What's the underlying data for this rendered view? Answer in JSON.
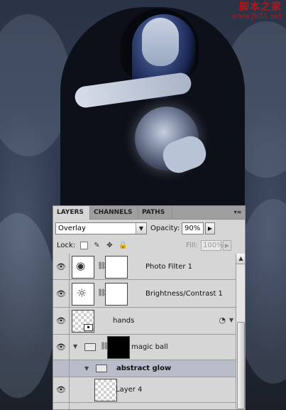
{
  "watermark": {
    "line1": "脚本之家",
    "line2": "www.Jb51.net"
  },
  "panel": {
    "tabs": [
      {
        "label": "LAYERS",
        "active": true
      },
      {
        "label": "CHANNELS",
        "active": false
      },
      {
        "label": "PATHS",
        "active": false
      }
    ],
    "menu_icon": "panel-menu-icon",
    "blend_mode": "Overlay",
    "opacity_label": "Opacity:",
    "opacity_value": "90%",
    "lock_label": "Lock:",
    "fill_label": "Fill:",
    "fill_value": "100%"
  },
  "layers": [
    {
      "name": "Photo Filter 1",
      "kind": "adjustment",
      "icon": "photo-filter-icon",
      "visible": true
    },
    {
      "name": "Brightness/Contrast 1",
      "kind": "adjustment",
      "icon": "brightness-contrast-icon",
      "visible": true
    },
    {
      "name": "hands",
      "kind": "smart-object",
      "visible": true,
      "has_effects": true
    },
    {
      "name": "magic ball",
      "kind": "group",
      "visible": true,
      "expanded": true
    },
    {
      "name": "abstract glow",
      "kind": "group",
      "visible": false,
      "expanded": true,
      "selected": true
    },
    {
      "name": "Layer 4",
      "kind": "pixel",
      "visible": true
    }
  ]
}
